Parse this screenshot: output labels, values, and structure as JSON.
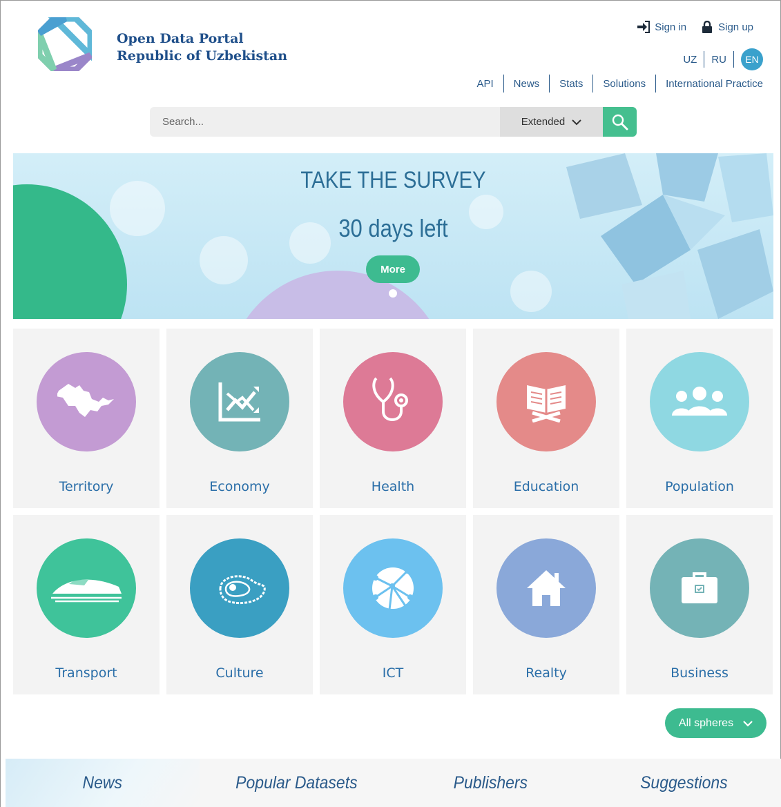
{
  "header": {
    "brand_line1": "Open Data Portal",
    "brand_line2": "Republic of Uzbekistan",
    "auth": {
      "sign_in": "Sign in",
      "sign_up": "Sign up"
    },
    "languages": [
      "UZ",
      "RU",
      "EN"
    ],
    "active_language": "EN",
    "nav": [
      "API",
      "News",
      "Stats",
      "Solutions",
      "International Practice"
    ]
  },
  "search": {
    "placeholder": "Search...",
    "mode_label": "Extended"
  },
  "banner": {
    "title": "TAKE THE SURVEY",
    "subtitle": "30 days left",
    "button_label": "More"
  },
  "spheres": [
    {
      "label": "Territory",
      "color": "#c39bd3",
      "icon": "uzbekistan-map-icon"
    },
    {
      "label": "Economy",
      "color": "#73b3b6",
      "icon": "economy-chart-icon"
    },
    {
      "label": "Health",
      "color": "#dd7a96",
      "icon": "stethoscope-icon"
    },
    {
      "label": "Education",
      "color": "#e48a89",
      "icon": "open-book-icon"
    },
    {
      "label": "Population",
      "color": "#8fd8e2",
      "icon": "people-icon"
    },
    {
      "label": "Transport",
      "color": "#3fc39a",
      "icon": "train-icon"
    },
    {
      "label": "Culture",
      "color": "#3a9fc2",
      "icon": "paisley-icon"
    },
    {
      "label": "ICT",
      "color": "#6cc1ef",
      "icon": "network-globe-icon"
    },
    {
      "label": "Realty",
      "color": "#8aa8d9",
      "icon": "house-icon"
    },
    {
      "label": "Business",
      "color": "#74b3b6",
      "icon": "briefcase-icon"
    }
  ],
  "all_spheres_label": "All spheres",
  "tabs": [
    "News",
    "Popular Datasets",
    "Publishers",
    "Suggestions"
  ],
  "colors": {
    "accent_green": "#3dbb90",
    "brand_blue": "#1f4f8a",
    "link_blue": "#2a5a8a"
  }
}
